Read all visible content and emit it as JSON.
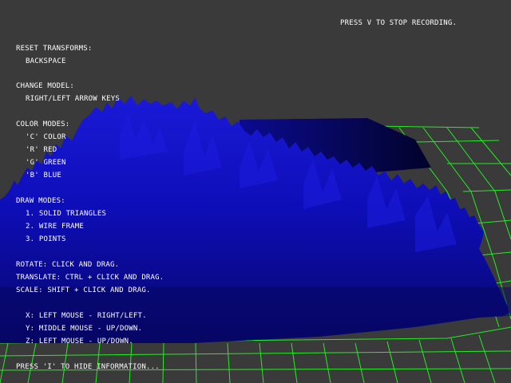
{
  "window": {
    "background": "#3a3a3a",
    "grid_color": "#22ee22",
    "model_color": "#1010c8"
  },
  "status": {
    "recording": "PRESS V TO STOP RECORDING."
  },
  "info": {
    "reset_heading": "RESET TRANSFORMS:",
    "reset_key": "BACKSPACE",
    "model_heading": "CHANGE MODEL:",
    "model_keys": "RIGHT/LEFT ARROW KEYS",
    "color_heading": "COLOR MODES:",
    "color_modes": [
      "'C' COLOR",
      "'R' RED",
      "'G' GREEN",
      "'B' BLUE"
    ],
    "draw_heading": "DRAW MODES:",
    "draw_modes": [
      "1. SOLID TRIANGLES",
      "2. WIRE FRAME",
      "3. POINTS"
    ],
    "rotate": "ROTATE: CLICK AND DRAG.",
    "translate": "TRANSLATE: CTRL + CLICK AND DRAG.",
    "scale": "SCALE: SHIFT + CLICK AND DRAG.",
    "axes": [
      "X: LEFT MOUSE - RIGHT/LEFT.",
      "Y: MIDDLE MOUSE - UP/DOWN.",
      "Z: LEFT MOUSE - UP/DOWN."
    ],
    "hide_hint": "PRESS 'I' TO HIDE INFORMATION..."
  }
}
